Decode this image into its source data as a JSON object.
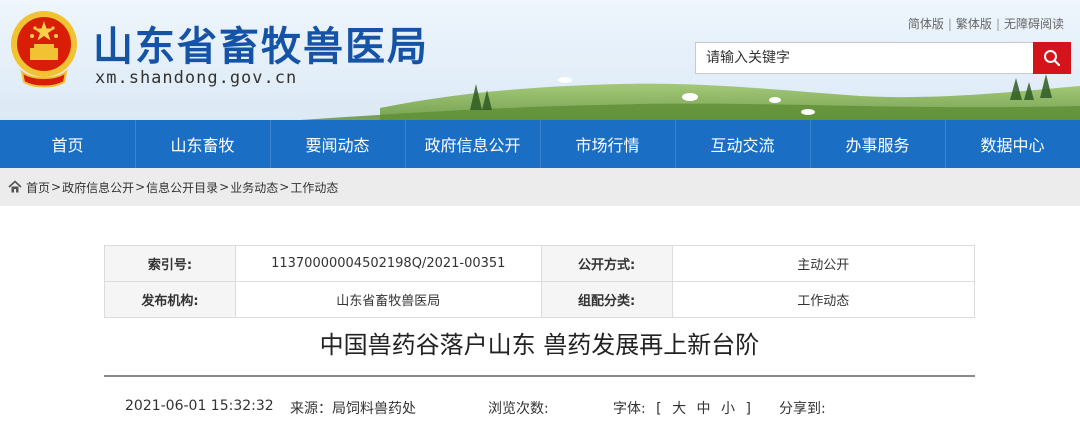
{
  "header": {
    "title": "山东省畜牧兽医局",
    "domain": "xm.shandong.gov.cn",
    "links": [
      "简体版",
      "繁体版",
      "无障碍阅读"
    ],
    "search_placeholder": "请输入关键字"
  },
  "nav": {
    "items": [
      "首页",
      "山东畜牧",
      "要闻动态",
      "政府信息公开",
      "市场行情",
      "互动交流",
      "办事服务",
      "数据中心"
    ]
  },
  "breadcrumb": [
    "首页",
    "政府信息公开",
    "信息公开目录",
    "业务动态",
    "工作动态"
  ],
  "info": {
    "index_label": "索引号:",
    "index_value": "11370000004502198Q/2021-00351",
    "disclosure_label": "公开方式:",
    "disclosure_value": "主动公开",
    "publisher_label": "发布机构:",
    "publisher_value": "山东省畜牧兽医局",
    "category_label": "组配分类:",
    "category_value": "工作动态"
  },
  "article": {
    "title": "中国兽药谷落户山东 兽药发展再上新台阶",
    "date": "2021-06-01 15:32:32",
    "source": "来源：局饲料兽药处",
    "views": "浏览次数:",
    "font_label": "字体:",
    "font_open": "[",
    "font_sizes": [
      "大",
      "中",
      "小"
    ],
    "font_close": "]",
    "share": "分享到:"
  },
  "colors": {
    "nav_bg": "#1a6fc4",
    "title_blue": "#1553a6",
    "search_red": "#d4131b"
  },
  "icons": [
    "national-emblem-icon",
    "search-icon",
    "home-icon"
  ]
}
